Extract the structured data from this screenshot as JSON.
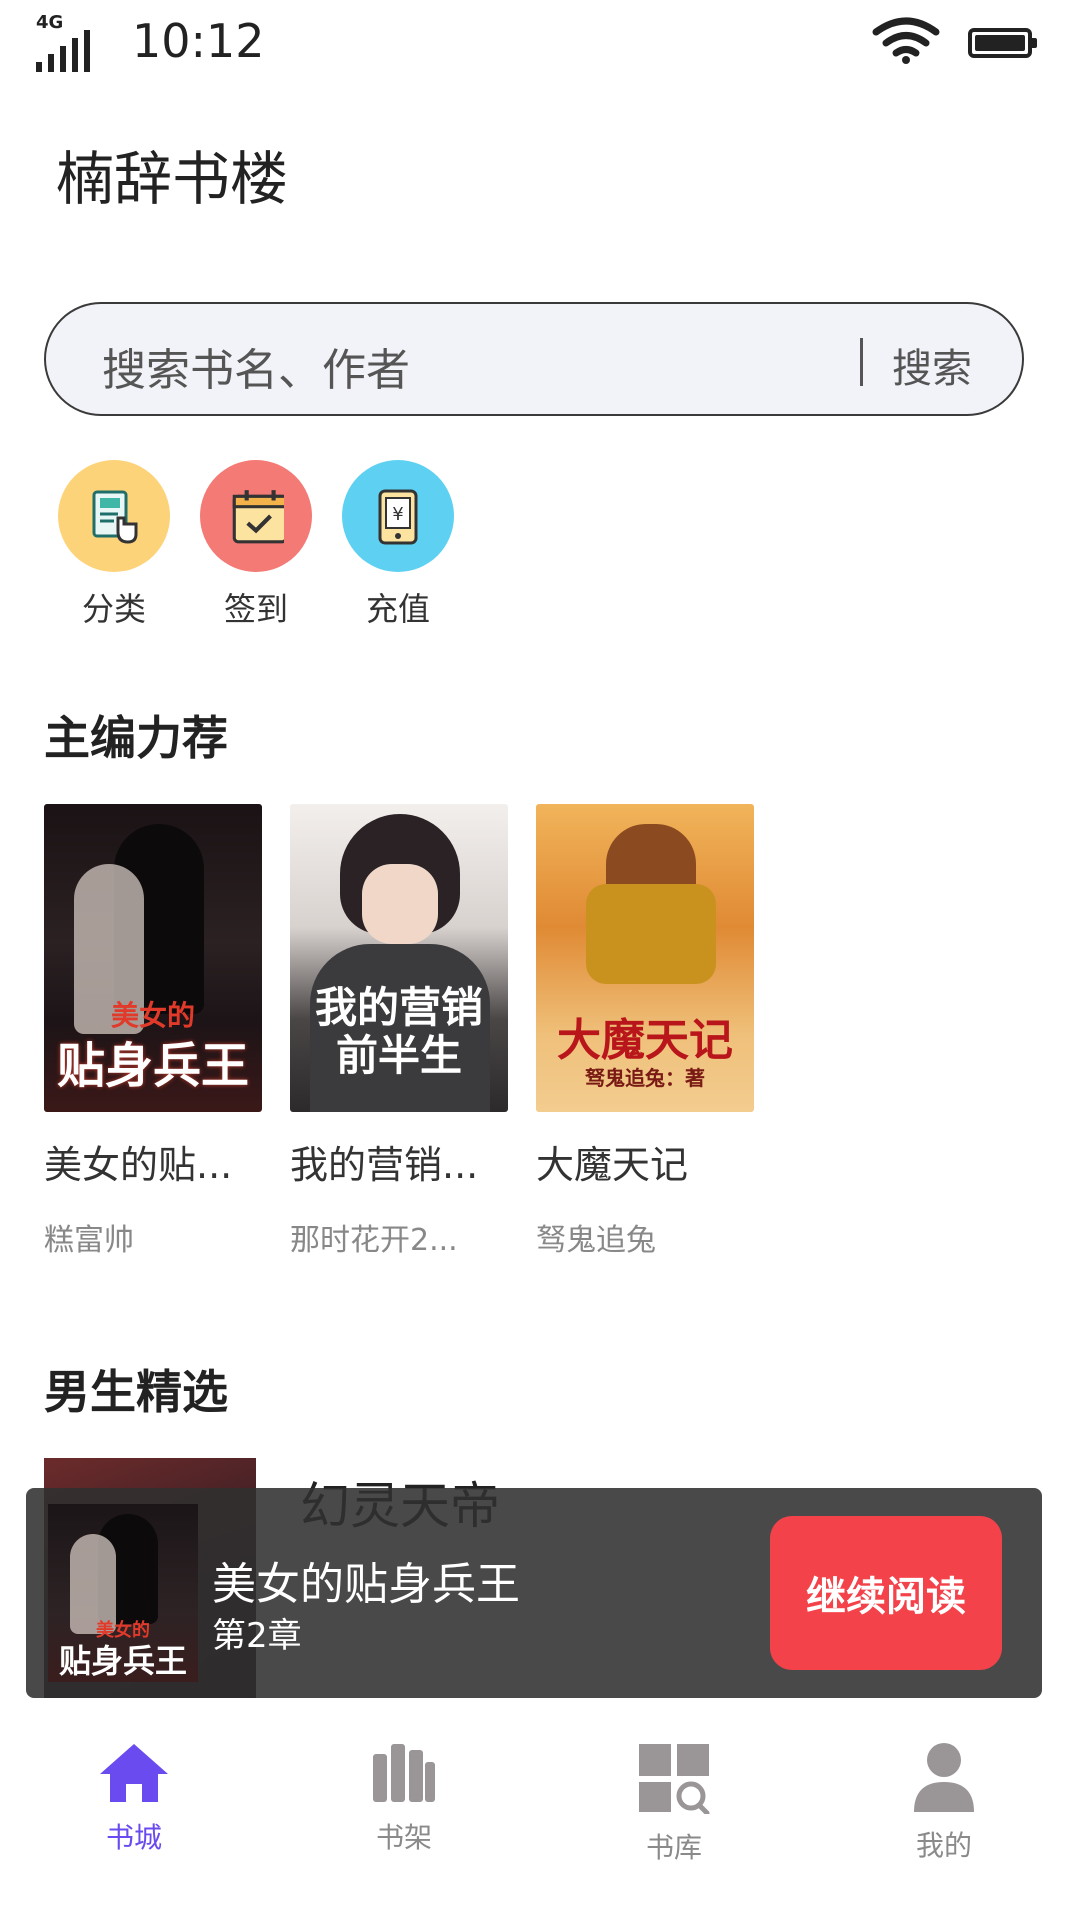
{
  "status_bar": {
    "network": "4G",
    "time": "10:12"
  },
  "app": {
    "title": "楠辞书楼"
  },
  "search": {
    "placeholder": "搜索书名、作者",
    "button_label": "搜索"
  },
  "quick_entries": [
    {
      "label": "分类",
      "icon": "category-icon",
      "color": "#fdd37a"
    },
    {
      "label": "签到",
      "icon": "calendar-check-icon",
      "color": "#f47a76"
    },
    {
      "label": "充值",
      "icon": "recharge-icon",
      "color": "#5ed1f3"
    }
  ],
  "editor_picks": {
    "title": "主编力荐",
    "books": [
      {
        "name": "美女的贴...",
        "author": "糕富帅",
        "cover_title": "贴身兵王",
        "cover_subtitle": "美女的"
      },
      {
        "name": "我的营销...",
        "author": "那时花开2...",
        "cover_title": "我的营销前半生"
      },
      {
        "name": "大魔天记",
        "author": "驽鬼追兔",
        "cover_title": "大魔天记",
        "cover_subtitle": "驽鬼追兔：著"
      }
    ]
  },
  "male_picks": {
    "title": "男生精选",
    "first_book_title": "幻灵天帝"
  },
  "continue_reading": {
    "book_name": "美女的贴身兵王",
    "chapter": "第2章",
    "button_label": "继续阅读",
    "cover_title": "贴身兵王",
    "cover_subtitle": "美女的"
  },
  "bottom_nav": {
    "items": [
      {
        "label": "书城",
        "icon": "home-icon",
        "active": true
      },
      {
        "label": "书架",
        "icon": "bookshelf-icon",
        "active": false
      },
      {
        "label": "书库",
        "icon": "library-search-icon",
        "active": false
      },
      {
        "label": "我的",
        "icon": "profile-icon",
        "active": false
      }
    ]
  },
  "colors": {
    "accent": "#6a4bf0",
    "continue_button": "#f3424a",
    "inactive_nav": "#8a8a8a"
  }
}
